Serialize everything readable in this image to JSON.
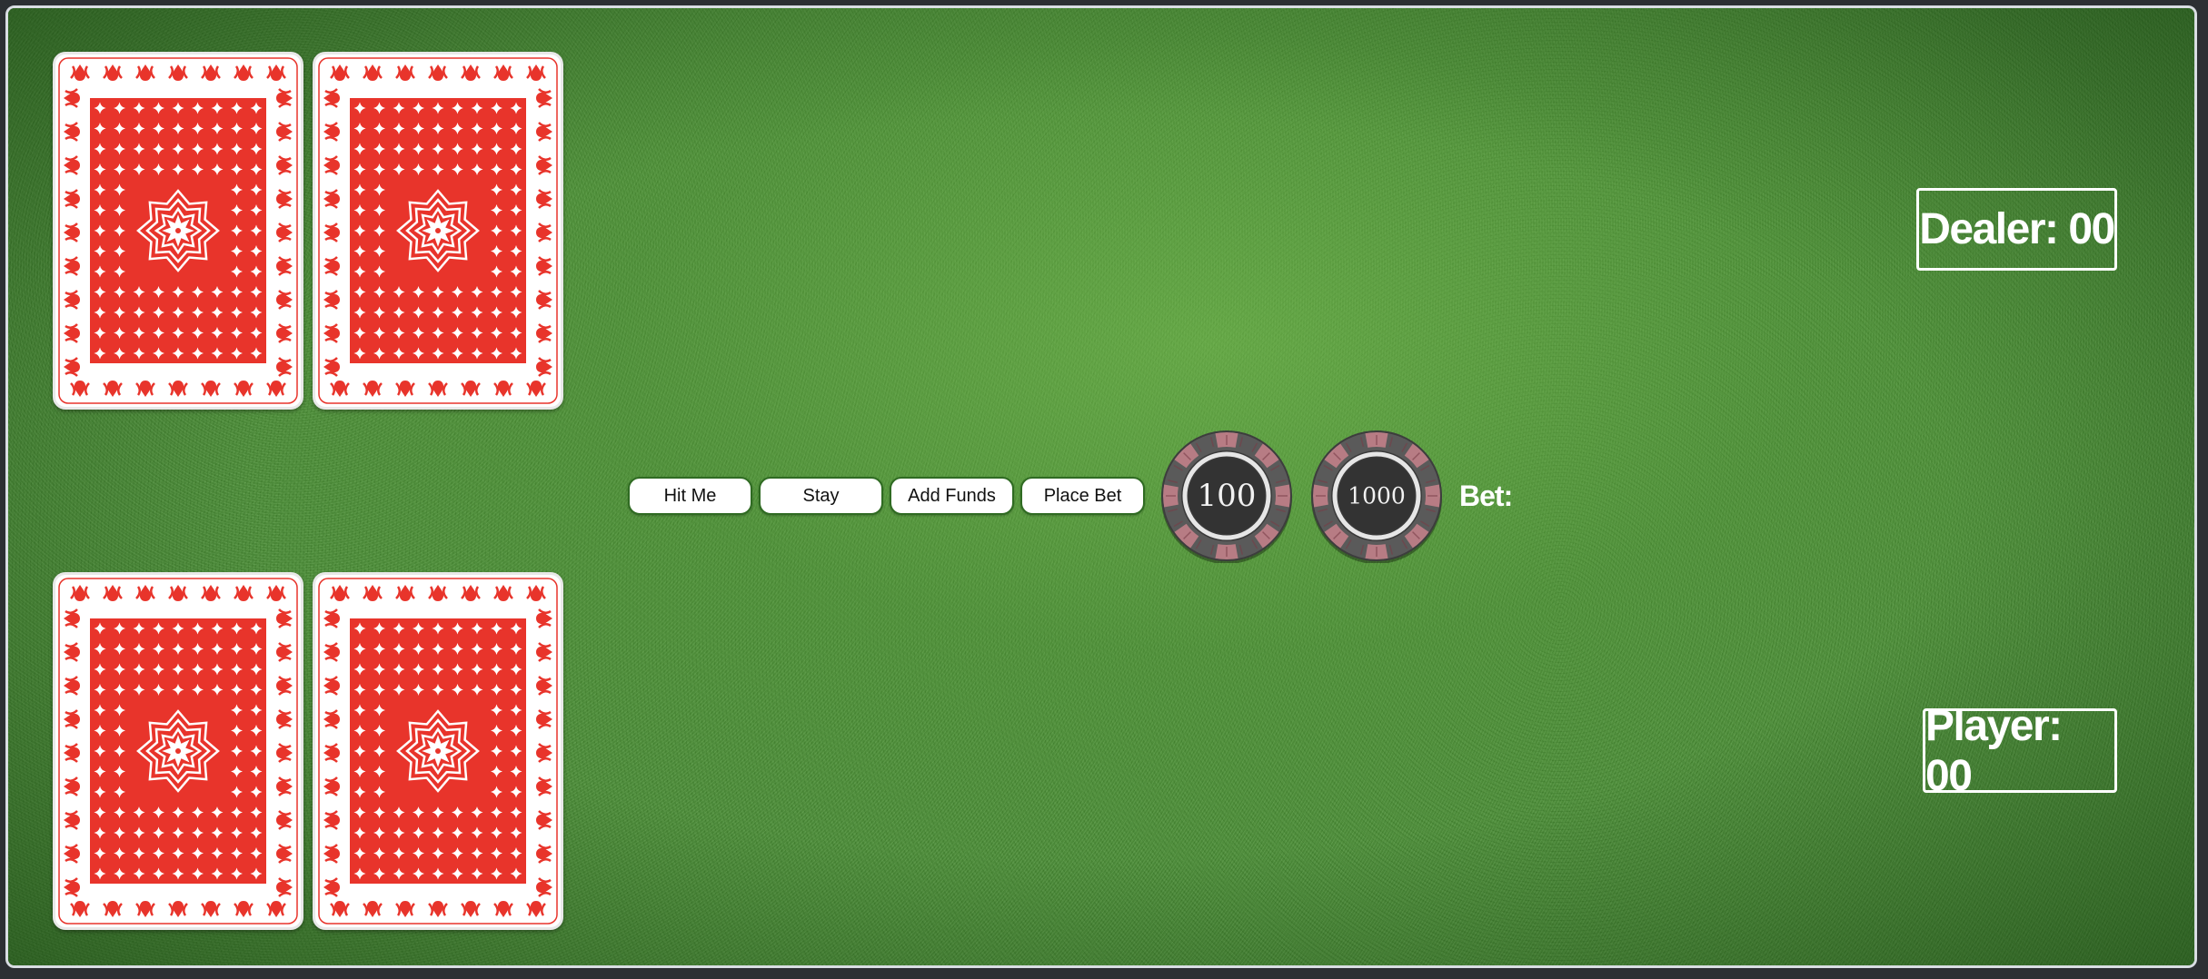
{
  "table": {
    "felt_color": "#4a8f35",
    "card_back_color": "#e8342b"
  },
  "dealer_hand": {
    "cards": [
      {
        "face": "back"
      },
      {
        "face": "back"
      }
    ]
  },
  "player_hand": {
    "cards": [
      {
        "face": "back"
      },
      {
        "face": "back"
      }
    ]
  },
  "controls": {
    "hit_label": "Hit Me",
    "stay_label": "Stay",
    "add_funds_label": "Add Funds",
    "place_bet_label": "Place Bet"
  },
  "chips": [
    {
      "value": "100",
      "color": "#5a5a5a",
      "ring_color": "#b77c84"
    },
    {
      "value": "1000",
      "color": "#5a5a5a",
      "ring_color": "#b77c84"
    }
  ],
  "bet": {
    "label": "Bet:",
    "amount": ""
  },
  "scores": {
    "dealer_label": "Dealer: 00",
    "player_label": "Player: 00"
  }
}
